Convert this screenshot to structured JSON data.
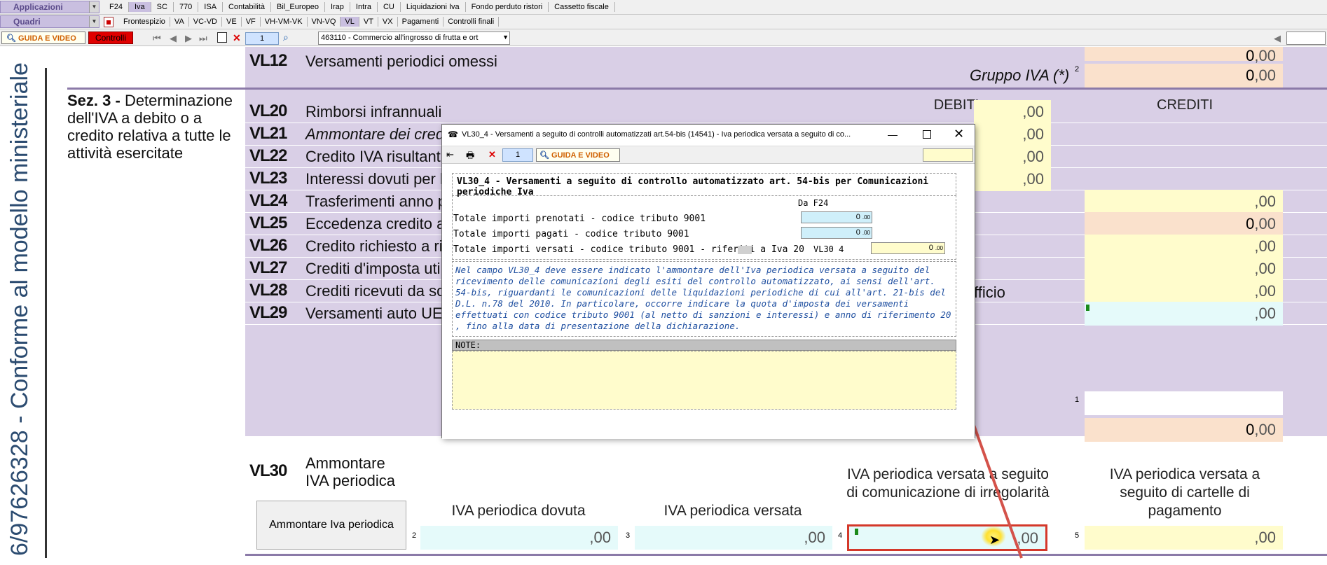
{
  "menu": {
    "applicazioni": "Applicazioni",
    "quadri": "Quadri",
    "tabs": [
      "F24",
      "Iva",
      "SC",
      "770",
      "ISA",
      "Contabilità",
      "Bil_Europeo",
      "Irap",
      "Intra",
      "CU",
      "Liquidazioni Iva",
      "Fondo perduto ristori",
      "Cassetto fiscale"
    ],
    "quadri_tabs": [
      "Frontespizio",
      "VA",
      "VC-VD",
      "VE",
      "VF",
      "VH-VM-VK",
      "VN-VQ",
      "VL",
      "VT",
      "VX",
      "Pagamenti",
      "Controlli finali"
    ]
  },
  "toolbar": {
    "guida": "GUIDA E VIDEO",
    "controlli": "Controlli",
    "page": "1",
    "attivita": "463110 - Commercio all'ingrosso di frutta e ort"
  },
  "side_text": "6/97626328 - Conforme al modello ministeriale",
  "form": {
    "vl12": {
      "code": "VL12",
      "label": "Versamenti periodici omessi",
      "gruppo": "Gruppo IVA (*)",
      "n2": "2",
      "v1": "0",
      "v2": "0"
    },
    "sez3": {
      "title_bold": "Sez. 3 -",
      "title": "Determinazione dell'IVA a debito o a credito relativa a tutte le attività esercitate"
    },
    "col_debiti": "DEBITI",
    "col_crediti": "CREDITI",
    "rows": [
      {
        "code": "VL20",
        "label": "Rimborsi infrannuali"
      },
      {
        "code": "VL21",
        "label": "Ammontare dei cred"
      },
      {
        "code": "VL22",
        "label": "Credito IVA risultant"
      },
      {
        "code": "VL23",
        "label": "Interessi dovuti per le"
      },
      {
        "code": "VL24",
        "label": "Trasferimenti anno p"
      },
      {
        "code": "VL25",
        "label": "Eccedenza credito a"
      },
      {
        "code": "VL26",
        "label": "Credito richiesto a ri"
      },
      {
        "code": "VL27",
        "label": "Crediti d'imposta utiliz"
      },
      {
        "code": "VL28",
        "label": "Crediti ricevuti da soci"
      },
      {
        "code": "VL29",
        "label": "Versamenti auto UE re"
      }
    ],
    "vl25_value": "0",
    "vl26_tail": "fficio",
    "decimals": ",00",
    "n1": "1",
    "total_value": "0",
    "vl30": {
      "code": "VL30",
      "label": "Ammontare IVA periodica",
      "button": "Ammontare Iva periodica",
      "col2": "IVA periodica dovuta",
      "col3": "IVA periodica versata",
      "col4": "IVA periodica versata a seguito di comunicazione di irregolarità",
      "col5": "IVA periodica versata a seguito di cartelle di pagamento",
      "n2": "2",
      "n3": "3",
      "n4": "4",
      "n5": "5"
    }
  },
  "dialog": {
    "title": "VL30_4 - Versamenti a seguito di controlli automatizzati art.54-bis (14541) - Iva periodica versata a seguito di co...",
    "page": "1",
    "guida": "GUIDA E VIDEO",
    "heading": "VL30_4 - Versamenti a seguito di controllo automatizzato art. 54-bis per Comunicazioni periodiche Iva",
    "da_f24": "Da F24",
    "r1_label": "Totale importi prenotati - codice tributo 9001",
    "r1_value": "0",
    "r2_label": "Totale importi pagati - codice tributo 9001",
    "r2_value": "0",
    "r3_label": "Totale importi versati - codice tributo 9001 - riferiti a Iva 20",
    "r3_ref": "VL30  4",
    "r3_value": "0",
    "dec": ".00",
    "info": "Nel campo VL30_4 deve essere indicato l'ammontare dell'Iva periodica versata a seguito del ricevimento delle comunicazioni degli esiti del controllo automatizzato, ai sensi dell'art. 54-bis, riguardanti le comunicazioni delle liquidazioni periodiche di cui all'art. 21-bis del D.L. n.78 del 2010. In particolare, occorre indicare la quota d'imposta dei versamenti effettuati con codice tributo 9001 (al netto di sanzioni e interessi) e anno di riferimento 20   , fino alla data di presentazione della dichiarazione.",
    "note": "NOTE:"
  }
}
